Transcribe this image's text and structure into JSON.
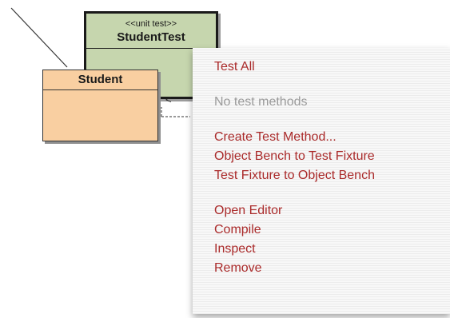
{
  "diagram": {
    "unit_test_class": {
      "stereotype": "<<unit test>>",
      "name": "StudentTest"
    },
    "student_class": {
      "name": "Student"
    },
    "dependency_label": "<"
  },
  "context_menu": {
    "groups": [
      [
        {
          "label": "Test All",
          "enabled": true
        }
      ],
      [
        {
          "label": "No test methods",
          "enabled": false
        }
      ],
      [
        {
          "label": "Create Test Method...",
          "enabled": true
        },
        {
          "label": "Object Bench to Test Fixture",
          "enabled": true
        },
        {
          "label": "Test Fixture to Object Bench",
          "enabled": true
        }
      ],
      [
        {
          "label": "Open Editor",
          "enabled": true
        },
        {
          "label": "Compile",
          "enabled": true
        },
        {
          "label": "Inspect",
          "enabled": true
        },
        {
          "label": "Remove",
          "enabled": true
        }
      ]
    ]
  },
  "colors": {
    "test_class_fill": "#c6d6ae",
    "student_class_fill": "#f9cfa1",
    "menu_text": "#aa2a2a",
    "menu_disabled_text": "#9a9a9a"
  }
}
